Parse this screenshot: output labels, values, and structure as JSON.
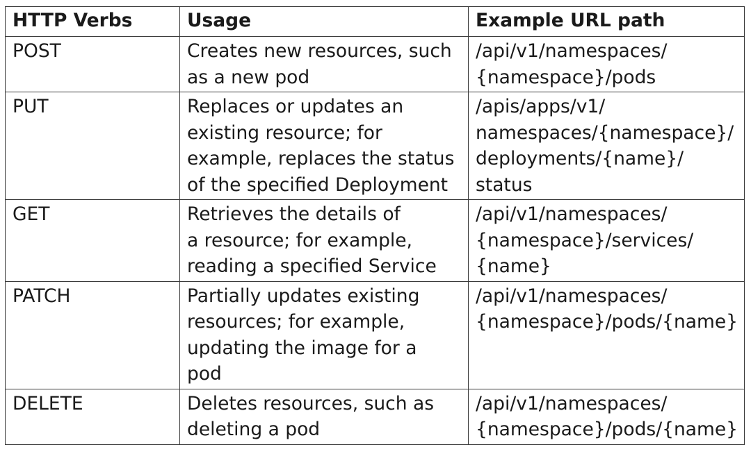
{
  "table": {
    "headers": [
      "HTTP Verbs",
      "Usage",
      "Example URL path"
    ],
    "rows": [
      {
        "verb": "POST",
        "usage": "Creates new resources, such\nas a new pod",
        "path": "/api/v1/namespaces/\n{namespace}/pods"
      },
      {
        "verb": "PUT",
        "usage": "Replaces or updates an\nexisting resource; for\nexample, replaces the status\nof the specified Deployment",
        "path": "/apis/apps/v1/\nnamespaces/{namespace}/\ndeployments/{name}/\nstatus"
      },
      {
        "verb": "GET",
        "usage": "Retrieves the details of\na resource; for example,\nreading a specified Service",
        "path": "/api/v1/namespaces/\n{namespace}/services/\n{name}"
      },
      {
        "verb": "PATCH",
        "usage": "Partially updates existing\nresources; for example,\nupdating the image for a\npod",
        "path": "/api/v1/namespaces/\n{namespace}/pods/{name}"
      },
      {
        "verb": "DELETE",
        "usage": "Deletes resources, such as\ndeleting a pod",
        "path": "/api/v1/namespaces/\n{namespace}/pods/{name}"
      }
    ]
  }
}
